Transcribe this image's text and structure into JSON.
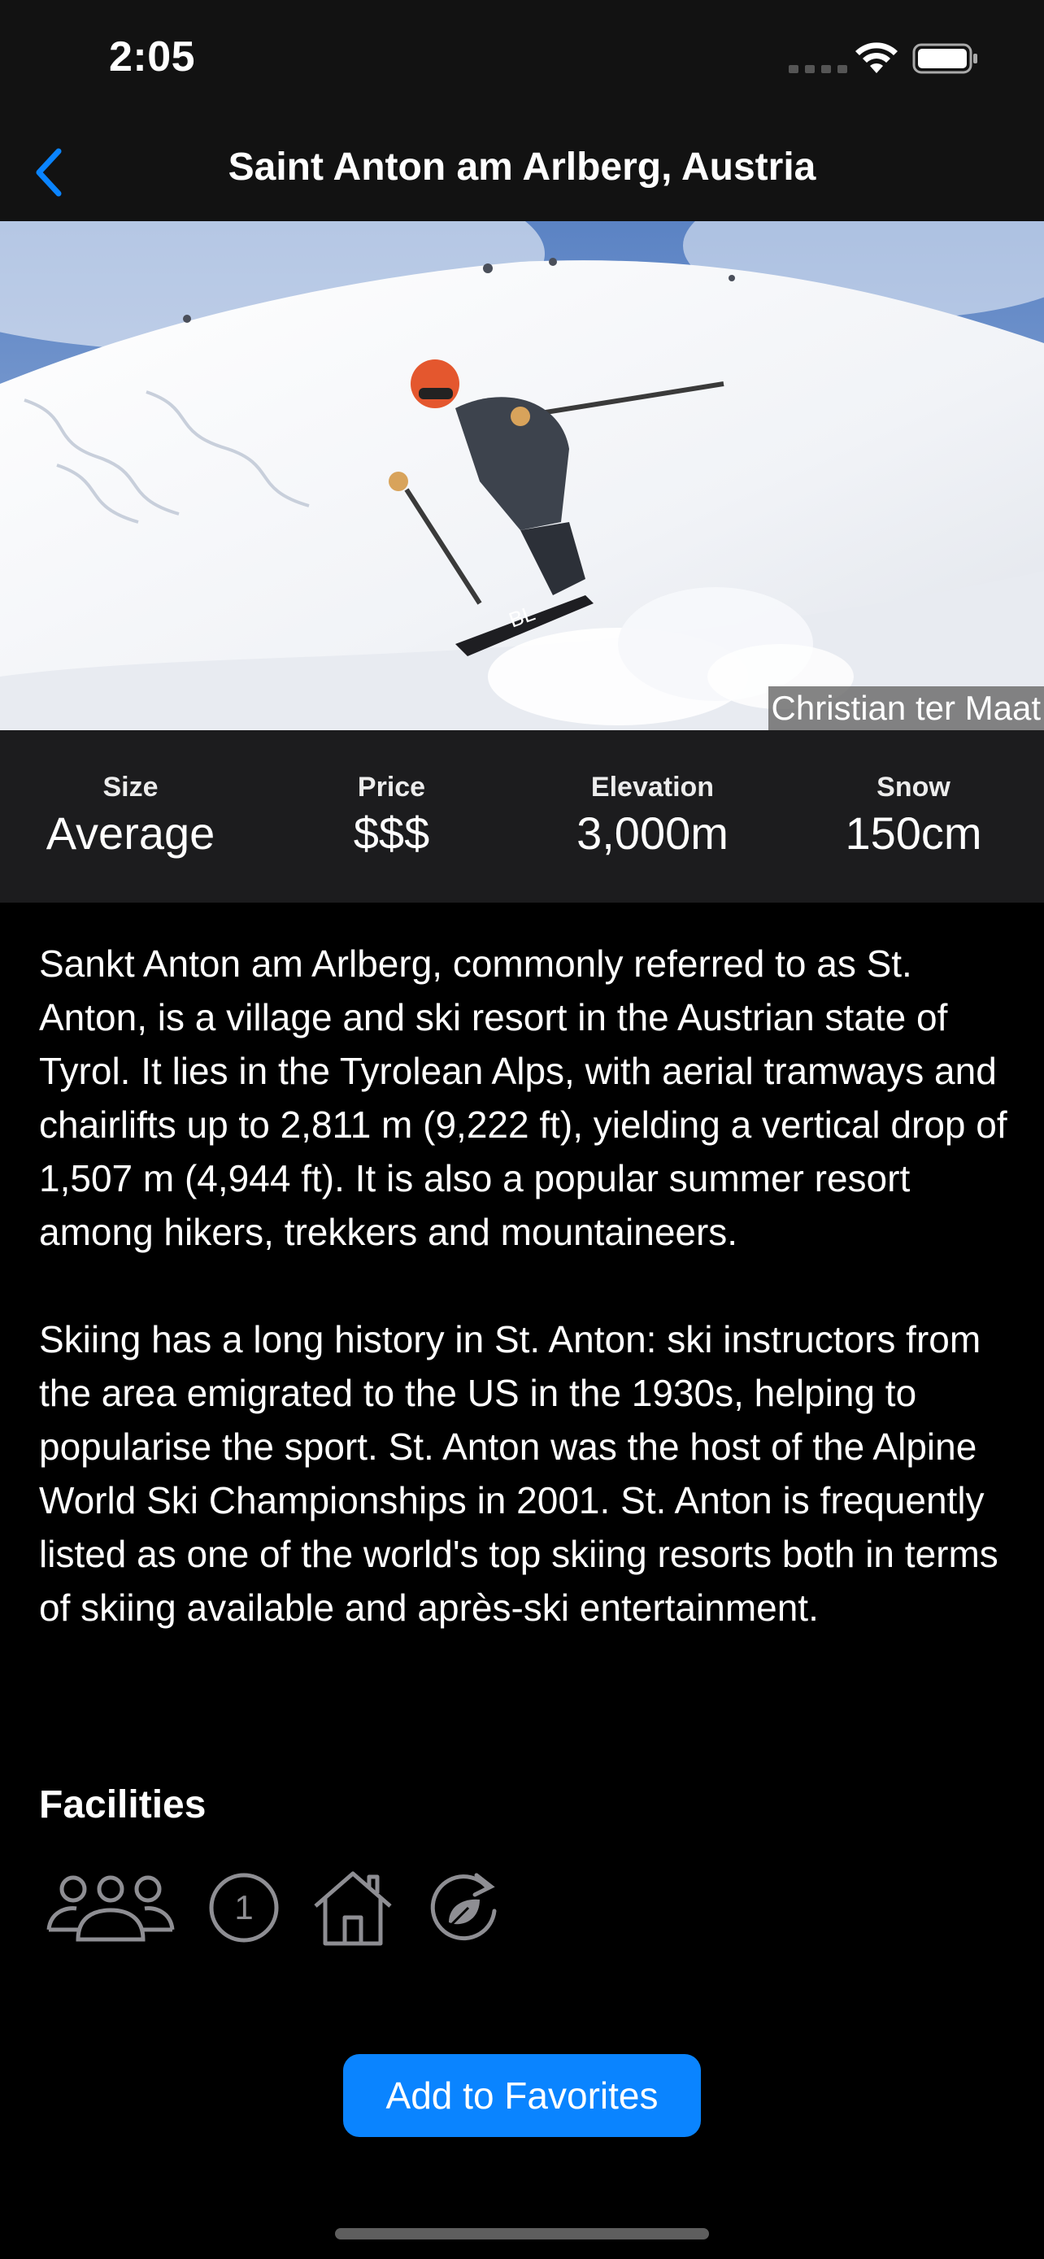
{
  "status_bar": {
    "time": "2:05"
  },
  "nav": {
    "title": "Saint Anton am Arlberg, Austria",
    "back_icon": "chevron-left-icon"
  },
  "hero": {
    "credit": "Christian ter Maat"
  },
  "stats": [
    {
      "label": "Size",
      "value": "Average"
    },
    {
      "label": "Price",
      "value": "$$$"
    },
    {
      "label": "Elevation",
      "value": "3,000m"
    },
    {
      "label": "Snow",
      "value": "150cm"
    }
  ],
  "description": {
    "paragraph1": "Sankt Anton am Arlberg, commonly referred to as St. Anton, is a village and ski resort in the Austrian state of Tyrol. It lies in the Tyrolean Alps, with aerial tramways and chairlifts up to 2,811 m (9,222 ft), yielding a vertical drop of 1,507 m (4,944 ft). It is also a popular summer resort among hikers, trekkers and mountaineers.",
    "paragraph2": "Skiing has a long history in St. Anton: ski instructors from the area emigrated to the US in the 1930s, helping to popularise the sport. St. Anton was the host of the Alpine World Ski Championships in 2001. St. Anton is frequently listed as one of the world's top skiing resorts both in terms of skiing available and après-ski entertainment."
  },
  "facilities": {
    "title": "Facilities",
    "icons": [
      "group-icon",
      "number-one-icon",
      "house-icon",
      "recycle-leaf-icon"
    ],
    "icon_color": "#8e8e93"
  },
  "actions": {
    "favorite_label": "Add to Favorites"
  },
  "colors": {
    "accent": "#0a84ff",
    "background": "#000000",
    "stats_background": "#1c1c1e"
  }
}
